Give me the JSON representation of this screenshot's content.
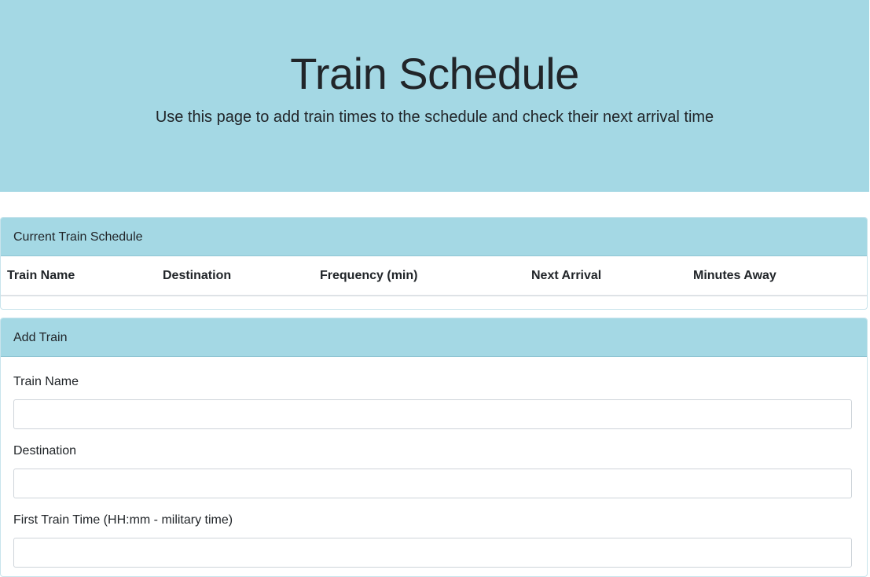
{
  "jumbotron": {
    "title": "Train Schedule",
    "subtitle": "Use this page to add train times to the schedule and check their next arrival time"
  },
  "schedule": {
    "header": "Current Train Schedule",
    "columns": [
      "Train Name",
      "Destination",
      "Frequency (min)",
      "Next Arrival",
      "Minutes Away"
    ]
  },
  "add_train": {
    "header": "Add Train",
    "fields": [
      {
        "label": "Train Name",
        "value": ""
      },
      {
        "label": "Destination",
        "value": ""
      },
      {
        "label": "First Train Time (HH:mm - military time)",
        "value": ""
      }
    ]
  },
  "colors": {
    "header_bg": "#a4d8e4",
    "text": "#212529"
  }
}
